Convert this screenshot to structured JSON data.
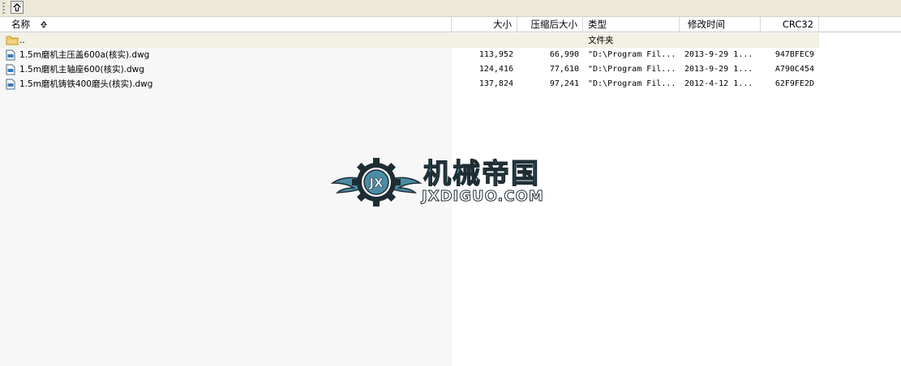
{
  "toolbar": {
    "up_button_icon": "up-folder-icon"
  },
  "columns": [
    {
      "key": "name",
      "label": "名称"
    },
    {
      "key": "size",
      "label": "大小"
    },
    {
      "key": "packed",
      "label": "压缩后大小"
    },
    {
      "key": "type",
      "label": "类型"
    },
    {
      "key": "modified",
      "label": "修改时间"
    },
    {
      "key": "crc",
      "label": "CRC32"
    }
  ],
  "parent_row": {
    "name": "..",
    "type": "文件夹"
  },
  "files": [
    {
      "name": "1.5m磨机主压盖600a(核实).dwg",
      "size": "113,952",
      "packed": "66,990",
      "type": "\"D:\\Program Fil...",
      "modified": "2013-9-29 1...",
      "crc": "947BFEC9"
    },
    {
      "name": "1.5m磨机主轴座600(核实).dwg",
      "size": "124,416",
      "packed": "77,610",
      "type": "\"D:\\Program Fil...",
      "modified": "2013-9-29 1...",
      "crc": "A790C454"
    },
    {
      "name": "1.5m磨机铸铁400磨头(核实).dwg",
      "size": "137,824",
      "packed": "97,241",
      "type": "\"D:\\Program Fil...",
      "modified": "2012-4-12 1...",
      "crc": "62F9FE2D"
    }
  ],
  "watermark": {
    "title": "机械帝国",
    "subtitle": "JXDIGUO.COM",
    "emblem_text": "JX"
  },
  "colors": {
    "toolbar_bg": "#ece9d8",
    "parent_row_bg": "#f3f0e4",
    "watermark_blue": "#4a8ca6"
  }
}
